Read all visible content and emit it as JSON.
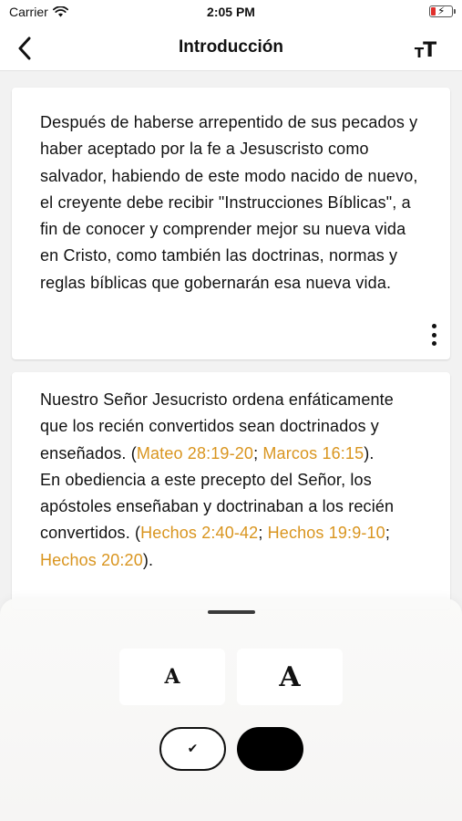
{
  "status_bar": {
    "carrier": "Carrier",
    "time": "2:05 PM"
  },
  "nav": {
    "title": "Introducción",
    "text_size_small": "T",
    "text_size_large": "T"
  },
  "cards": [
    {
      "text": "Después de haberse arrepentido de sus pecados y haber aceptado por la fe a Jesuscristo como salvador, habiendo de este modo nacido de nuevo, el creyente debe recibir \"Instrucciones Bíblicas\", a fin de conocer y comprender mejor su nueva vida en Cristo, como también las doctrinas, normas y reglas bíblicas que gobernarán esa nueva vida."
    },
    {
      "p1_text": "Nuestro Señor Jesucristo ordena enfáticamente que los recién convertidos sean doctrinados y enseñados. (",
      "p1_ref1": "Mateo 28:19-20",
      "p1_sep": "; ",
      "p1_ref2": "Marcos 16:15",
      "p1_end": ").",
      "p2_text": "En obediencia a este precepto del Señor, los apóstoles enseñaban y doctrinaban a los recién convertidos. (",
      "p2_ref1": "Hechos 2:40-42",
      "p2_sep1": "; ",
      "p2_ref2": "Hechos 19:9-10",
      "p2_sep2": "; ",
      "p2_ref3": "Hechos 20:20",
      "p2_end": ")."
    }
  ],
  "sheet": {
    "font_smaller_label": "A",
    "font_larger_label": "A",
    "light_theme_check": "✔"
  },
  "colors": {
    "reference": "#d9951f",
    "dark_theme": "#000000"
  }
}
